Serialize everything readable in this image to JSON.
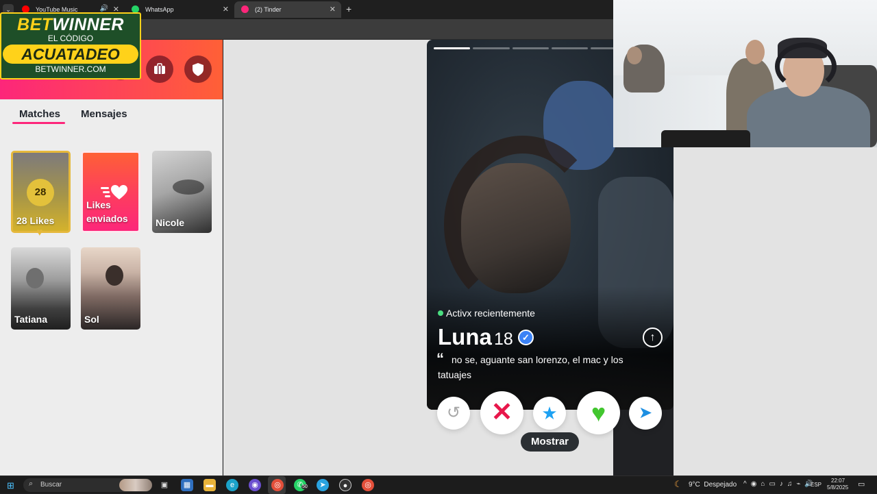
{
  "browser": {
    "tabs": [
      {
        "label": "YouTube Music",
        "favicon_color": "#ff0000"
      },
      {
        "label": "WhatsApp",
        "favicon_color": "#25d366"
      },
      {
        "label": "(2) Tinder",
        "favicon_color": "#fd267a"
      }
    ],
    "close_glyph": "✕",
    "new_tab_glyph": "+",
    "tab_menu_glyph": "⌄",
    "speaker_glyph": "🔊"
  },
  "overlay_ad": {
    "brand_part1": "BET",
    "brand_part2": "WINNER",
    "subtitle": "EL CÓDIGO",
    "code": "ACUATADEO",
    "site": "BETWINNER.COM"
  },
  "sidebar": {
    "header_icons": [
      "profile-icon",
      "explore-icon",
      "briefcase-icon",
      "shield-icon"
    ],
    "tabs": [
      {
        "label": "Matches",
        "active": true
      },
      {
        "label": "Mensajes",
        "active": false
      }
    ],
    "likes_card": {
      "count": "28",
      "label": "28 Likes"
    },
    "sent_card": {
      "label": "Likes enviados"
    },
    "matches": [
      {
        "name": "Nicole"
      },
      {
        "name": "Tatiana"
      },
      {
        "name": "Sol"
      }
    ]
  },
  "profile": {
    "status": "Activx recientemente",
    "name": "Luna",
    "age": "18",
    "verified": true,
    "bio": "no se, aguante san lorenzo, el mac y los tatuajes",
    "photo_count": 6,
    "photo_index": 1
  },
  "actions": {
    "rewind": "↺",
    "nope": "✕",
    "super_like": "★",
    "like": "♥",
    "boost": "➤",
    "show_label": "Mostrar"
  },
  "taskbar": {
    "search_label": "Buscar",
    "weather": "9°C",
    "weather_desc": "Despejado",
    "language": "ESP",
    "time": "22:07",
    "date": "5/8/2025",
    "whatsapp_badge": "50"
  },
  "colors": {
    "tinder_gradient_start": "#fd267a",
    "tinder_gradient_end": "#ff6036",
    "likes_gold": "#e5b83b",
    "nope_red": "#e8174b",
    "like_green": "#42c62f",
    "super_blue": "#1da1f2"
  }
}
